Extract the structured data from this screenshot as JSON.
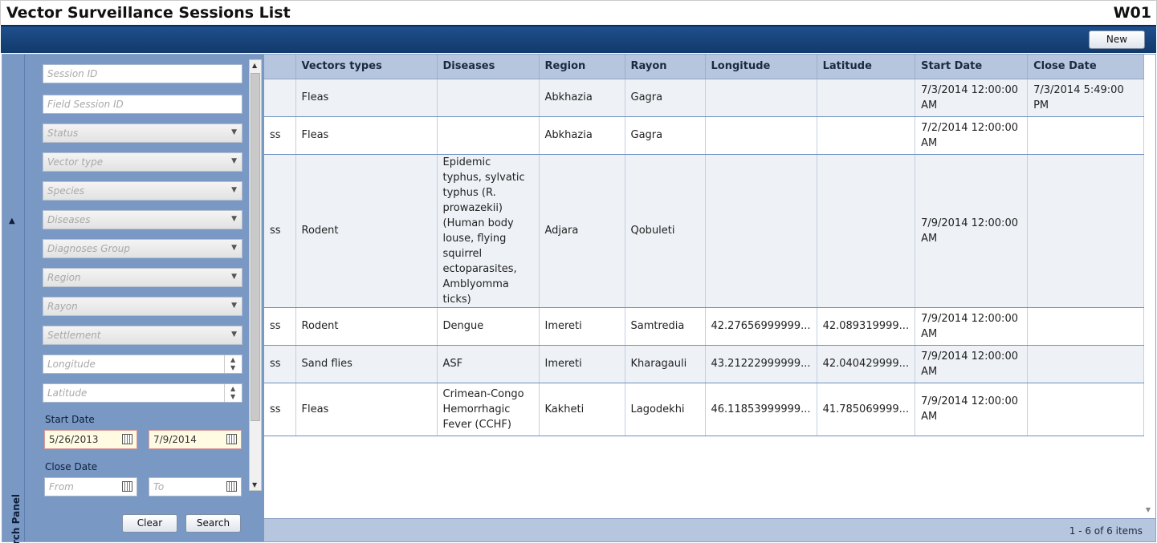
{
  "header": {
    "title": "Vector Surveillance Sessions List",
    "code": "W01"
  },
  "toolbar": {
    "new_label": "New"
  },
  "search_panel": {
    "label": "Search Panel",
    "session_id_placeholder": "Session ID",
    "field_session_id_placeholder": "Field Session ID",
    "status_placeholder": "Status",
    "vector_type_placeholder": "Vector type",
    "species_placeholder": "Species",
    "diseases_placeholder": "Diseases",
    "diagnoses_group_placeholder": "Diagnoses Group",
    "region_placeholder": "Region",
    "rayon_placeholder": "Rayon",
    "settlement_placeholder": "Settlement",
    "longitude_placeholder": "Longitude",
    "latitude_placeholder": "Latitude",
    "start_date_label": "Start Date",
    "start_date_from": "5/26/2013",
    "start_date_to": "7/9/2014",
    "close_date_label": "Close Date",
    "close_date_from_placeholder": "From",
    "close_date_to_placeholder": "To",
    "clear_label": "Clear",
    "search_label": "Search"
  },
  "grid": {
    "columns": [
      "Vectors types",
      "Diseases",
      "Region",
      "Rayon",
      "Longitude",
      "Latitude",
      "Start Date",
      "Close Date"
    ],
    "rows": [
      {
        "status_fragment": "",
        "vectors": "Fleas",
        "diseases": "",
        "region": "Abkhazia",
        "rayon": "Gagra",
        "longitude": "",
        "latitude": "",
        "start": "7/3/2014 12:00:00 AM",
        "close": "7/3/2014 5:49:00 PM"
      },
      {
        "status_fragment": "ss",
        "vectors": "Fleas",
        "diseases": "",
        "region": "Abkhazia",
        "rayon": "Gagra",
        "longitude": "",
        "latitude": "",
        "start": "7/2/2014 12:00:00 AM",
        "close": ""
      },
      {
        "status_fragment": "ss",
        "vectors": "Rodent",
        "diseases": "Epidemic typhus, sylvatic typhus (R. prowazekii) (Human body louse, flying squirrel ectoparasites, Amblyomma ticks)",
        "region": "Adjara",
        "rayon": "Qobuleti",
        "longitude": "",
        "latitude": "",
        "start": "7/9/2014 12:00:00 AM",
        "close": ""
      },
      {
        "status_fragment": "ss",
        "vectors": "Rodent",
        "diseases": "Dengue",
        "region": "Imereti",
        "rayon": "Samtredia",
        "longitude": "42.27656999999...",
        "latitude": "42.089319999...",
        "start": "7/9/2014 12:00:00 AM",
        "close": ""
      },
      {
        "status_fragment": "ss",
        "vectors": "Sand flies",
        "diseases": "ASF",
        "region": "Imereti",
        "rayon": "Kharagauli",
        "longitude": "43.21222999999...",
        "latitude": "42.040429999...",
        "start": "7/9/2014 12:00:00 AM",
        "close": ""
      },
      {
        "status_fragment": "ss",
        "vectors": "Fleas",
        "diseases": "Crimean-Congo Hemorrhagic Fever (CCHF)",
        "region": "Kakheti",
        "rayon": "Lagodekhi",
        "longitude": "46.11853999999...",
        "latitude": "41.785069999...",
        "start": "7/9/2014 12:00:00 AM",
        "close": ""
      }
    ],
    "pager": "1 - 6 of 6 items"
  }
}
